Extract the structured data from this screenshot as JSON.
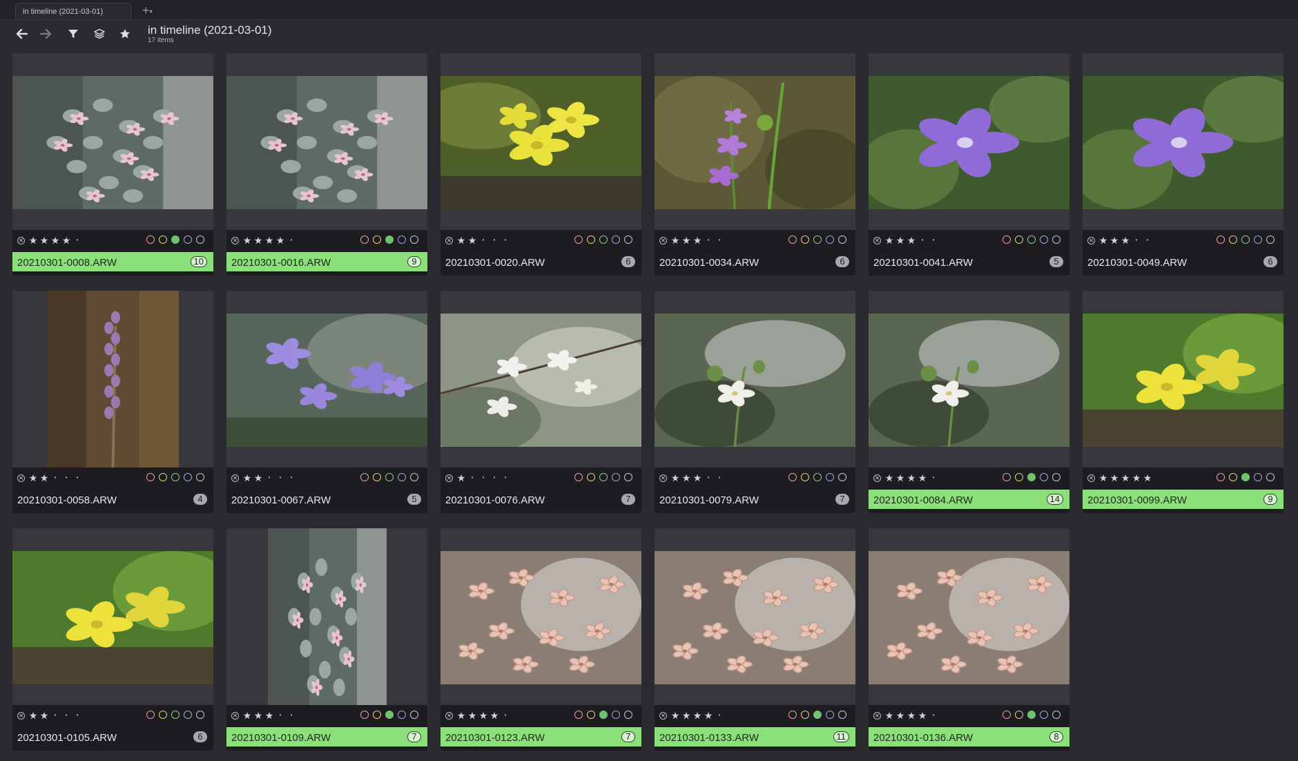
{
  "tab": {
    "label": "in timeline (2021-03-01)",
    "add_symbol": "+",
    "add_menu_symbol": "▾"
  },
  "toolbar": {
    "title": "in timeline (2021-03-01)",
    "subtitle": "17 items",
    "icons": [
      "arrow-left-icon",
      "arrow-right-icon",
      "filter-icon",
      "layers-icon",
      "star-icon"
    ]
  },
  "symbols": {
    "star_full": "★",
    "star_empty": "•"
  },
  "colors": {
    "selected": "#8be07a",
    "label_red": "#e8a0a0",
    "label_yellow": "#e0d080",
    "label_green": "#6ec36e",
    "label_blue": "#98a8e0",
    "label_purple": "#c8c8d0"
  },
  "grid": {
    "items": [
      {
        "filename": "20210301-0008.ARW",
        "count": "10",
        "stars": 4,
        "green": true,
        "selected": true,
        "orientation": "landscape",
        "subject": "pink-succulent-flowers"
      },
      {
        "filename": "20210301-0016.ARW",
        "count": "9",
        "stars": 4,
        "green": true,
        "selected": true,
        "orientation": "landscape",
        "subject": "pink-succulent-flowers"
      },
      {
        "filename": "20210301-0020.ARW",
        "count": "6",
        "stars": 2,
        "green": false,
        "selected": false,
        "orientation": "landscape",
        "subject": "yellow-flowers"
      },
      {
        "filename": "20210301-0034.ARW",
        "count": "6",
        "stars": 3,
        "green": false,
        "selected": false,
        "orientation": "landscape",
        "subject": "small-purple-flowers"
      },
      {
        "filename": "20210301-0041.ARW",
        "count": "5",
        "stars": 3,
        "green": false,
        "selected": false,
        "orientation": "landscape",
        "subject": "periwinkle-flower"
      },
      {
        "filename": "20210301-0049.ARW",
        "count": "6",
        "stars": 3,
        "green": false,
        "selected": false,
        "orientation": "landscape",
        "subject": "periwinkle-flower"
      },
      {
        "filename": "20210301-0058.ARW",
        "count": "4",
        "stars": 2,
        "green": false,
        "selected": false,
        "orientation": "portrait",
        "subject": "orchid-spike"
      },
      {
        "filename": "20210301-0067.ARW",
        "count": "5",
        "stars": 2,
        "green": false,
        "selected": false,
        "orientation": "landscape",
        "subject": "violets"
      },
      {
        "filename": "20210301-0076.ARW",
        "count": "7",
        "stars": 1,
        "green": false,
        "selected": false,
        "orientation": "landscape",
        "subject": "white-blossoms"
      },
      {
        "filename": "20210301-0079.ARW",
        "count": "7",
        "stars": 3,
        "green": false,
        "selected": false,
        "orientation": "landscape",
        "subject": "white-blossom"
      },
      {
        "filename": "20210301-0084.ARW",
        "count": "14",
        "stars": 4,
        "green": true,
        "selected": true,
        "orientation": "landscape",
        "subject": "white-blossom"
      },
      {
        "filename": "20210301-0099.ARW",
        "count": "9",
        "stars": 5,
        "green": true,
        "selected": true,
        "orientation": "landscape",
        "subject": "yellow-poppies"
      },
      {
        "filename": "20210301-0105.ARW",
        "count": "6",
        "stars": 2,
        "green": false,
        "selected": false,
        "orientation": "landscape",
        "subject": "yellow-poppies"
      },
      {
        "filename": "20210301-0109.ARW",
        "count": "7",
        "stars": 3,
        "green": true,
        "selected": true,
        "orientation": "portrait",
        "subject": "pink-succulent-flowers"
      },
      {
        "filename": "20210301-0123.ARW",
        "count": "7",
        "stars": 4,
        "green": true,
        "selected": true,
        "orientation": "landscape",
        "subject": "pink-star-flowers"
      },
      {
        "filename": "20210301-0133.ARW",
        "count": "11",
        "stars": 4,
        "green": true,
        "selected": true,
        "orientation": "landscape",
        "subject": "pink-star-flowers"
      },
      {
        "filename": "20210301-0136.ARW",
        "count": "8",
        "stars": 4,
        "green": true,
        "selected": true,
        "orientation": "landscape",
        "subject": "pink-star-flowers"
      }
    ]
  }
}
